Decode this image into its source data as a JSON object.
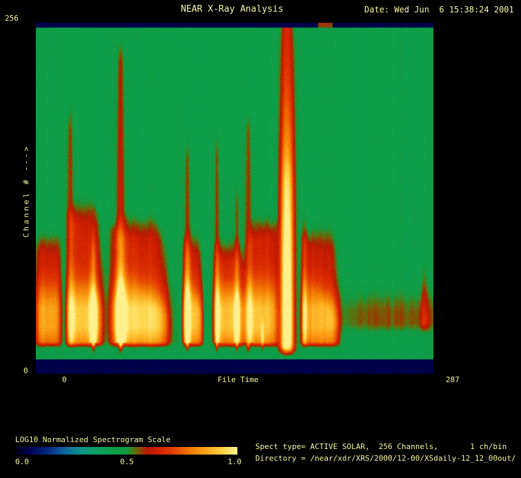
{
  "theme": {
    "background": "#000000",
    "text_color": "#f7f7a2"
  },
  "header": {
    "title": "NEAR X-Ray Analysis",
    "date": "Date: Wed Jun  6 15:38:24 2001"
  },
  "plot": {
    "y_axis": {
      "label": "Channel # --->",
      "max_label": "256",
      "min_label": "0"
    },
    "x_axis": {
      "title": "File Time",
      "min_label": "0",
      "max_label": "287"
    }
  },
  "colorbar": {
    "label": "LOG10 Normalized Spectrogram Scale",
    "ticks": [
      "0.0",
      "0.5",
      "1.0"
    ]
  },
  "info": {
    "line1": "Spect type= ACTIVE SOLAR,  256 Channels,       1 ch/bin",
    "line2": "Directory = /near/xdr/XRS/2000/12-00/XSdaily-12_12_00out/"
  },
  "chart_data": {
    "type": "heatmap",
    "title": "NEAR X-Ray Analysis spectrogram",
    "xlabel": "File Time",
    "ylabel": "Channel #",
    "x_range": [
      0,
      287
    ],
    "y_range": [
      0,
      256
    ],
    "scale_label": "LOG10 Normalized Spectrogram Scale",
    "scale_ticks": [
      0.0,
      0.5,
      1.0
    ],
    "background_level": 0.455,
    "strip_level": 0.046,
    "top_strip_mark": {
      "x0": 203.3,
      "x1": 214.2
    },
    "palette": [
      [
        0.0,
        "#000020"
      ],
      [
        0.05,
        "#00004e"
      ],
      [
        0.11,
        "#001c6e"
      ],
      [
        0.17,
        "#0a4292"
      ],
      [
        0.23,
        "#0c6f9e"
      ],
      [
        0.29,
        "#0d918b"
      ],
      [
        0.35,
        "#0e9f68"
      ],
      [
        0.42,
        "#0da151"
      ],
      [
        0.5,
        "#129a40"
      ],
      [
        0.53,
        "#4f7d14"
      ],
      [
        0.56,
        "#8a4a00"
      ],
      [
        0.59,
        "#b31a00"
      ],
      [
        0.64,
        "#d32000"
      ],
      [
        0.7,
        "#e23a00"
      ],
      [
        0.78,
        "#f17500"
      ],
      [
        0.86,
        "#fca71b"
      ],
      [
        0.93,
        "#ffd245"
      ],
      [
        1.0,
        "#fff08e"
      ]
    ],
    "events": [
      {
        "name": "flare-blob-1",
        "xc": 8.8,
        "bw": 9.2,
        "sw": 4.0,
        "st": 0.6,
        "tl": 0.66,
        "tr": 0.63,
        "amp": 0.4,
        "pe": 6
      },
      {
        "name": "flare-spike-2",
        "xc": 24.4,
        "bw": 3.0,
        "sw": 1.1,
        "st": 0.218,
        "tl": 0.62,
        "tr": 0.62,
        "amp": 0.33,
        "pe": 2
      },
      {
        "name": "flare-blob-2",
        "xc": 35.9,
        "bw": 12.4,
        "sw": 5.0,
        "st": 0.5,
        "tl": 0.561,
        "tr": 0.748,
        "amp": 0.46,
        "pe": 6
      },
      {
        "name": "flare-crest-2b",
        "xc": 41.3,
        "bw": 2.4,
        "sw": 1.0,
        "st": 0.59,
        "tl": 0.76,
        "tr": 0.76,
        "amp": 0.34,
        "pe": 2,
        "deep": true
      },
      {
        "name": "flare-spike-3",
        "xc": 61.0,
        "bw": 3.2,
        "sw": 1.4,
        "st": 0.017,
        "tl": 0.62,
        "tr": 0.62,
        "amp": 0.44,
        "pe": 2,
        "deep": true
      },
      {
        "name": "flare-blob-3",
        "xc": 74.7,
        "bw": 21.5,
        "sw": 8.0,
        "st": 0.55,
        "tl": 0.6,
        "tr": 0.8,
        "amp": 0.5,
        "pe": 6
      },
      {
        "name": "faint-line-a",
        "xc": 101.1,
        "bw": 1.6,
        "sw": 1.0,
        "st": 0.15,
        "tl": 0.93,
        "tr": 0.93,
        "amp": 0.07,
        "pe": 2
      },
      {
        "name": "flare-spike-4",
        "xc": 109.1,
        "bw": 2.2,
        "sw": 1.0,
        "st": 0.312,
        "tl": 0.64,
        "tr": 0.64,
        "amp": 0.36,
        "pe": 2,
        "deep": true
      },
      {
        "name": "flare-blob-4",
        "xc": 113.1,
        "bw": 7.2,
        "sw": 3.5,
        "st": 0.6,
        "tl": 0.635,
        "tr": 0.79,
        "amp": 0.44,
        "pe": 6
      },
      {
        "name": "flare-spike-5a",
        "xc": 130.5,
        "bw": 2.0,
        "sw": 1.0,
        "st": 0.3,
        "tl": 0.66,
        "tr": 0.66,
        "amp": 0.32,
        "pe": 2,
        "deep": true
      },
      {
        "name": "flare-blob-5",
        "xc": 139.4,
        "bw": 11.2,
        "sw": 5.0,
        "st": 0.62,
        "tl": 0.655,
        "tr": 0.74,
        "amp": 0.45,
        "pe": 6
      },
      {
        "name": "flare-spike-5b",
        "xc": 145.0,
        "bw": 1.8,
        "sw": 0.9,
        "st": 0.447,
        "tl": 0.74,
        "tr": 0.74,
        "amp": 0.31,
        "pe": 2,
        "deep": true
      },
      {
        "name": "flare-spike-6",
        "xc": 153.0,
        "bw": 3.0,
        "sw": 1.2,
        "st": 0.23,
        "tl": 0.68,
        "tr": 0.68,
        "amp": 0.34,
        "pe": 2,
        "deep": true
      },
      {
        "name": "flare-blob-6",
        "xc": 163.4,
        "bw": 11.0,
        "sw": 5.0,
        "st": 0.55,
        "tl": 0.675,
        "tr": 0.6,
        "amp": 0.45,
        "pe": 6
      },
      {
        "name": "tail-mark-6c",
        "xc": 163.4,
        "bw": 1.3,
        "sw": 0.9,
        "st": 0.86,
        "tl": 0.93,
        "tr": 0.93,
        "amp": 0.28,
        "pe": 2,
        "deep": true
      },
      {
        "name": "bright-column",
        "xc": 181.1,
        "bw": 5.3,
        "sw": 4.2,
        "st": 0.0,
        "tl": 0.1,
        "tr": 0.1,
        "amp": 0.56,
        "pe": 2.4,
        "kind": "column"
      },
      {
        "name": "column-glow",
        "xc": 181.1,
        "bw": 3.6,
        "sw": 3.0,
        "st": 0.36,
        "tl": 0.46,
        "tr": 0.46,
        "amp": 0.13,
        "pe": 2
      },
      {
        "name": "flare-spike-8",
        "xc": 193.5,
        "bw": 2.0,
        "sw": 1.0,
        "st": 0.54,
        "tl": 0.64,
        "tr": 0.64,
        "amp": 0.3,
        "pe": 2
      },
      {
        "name": "flare-blob-8",
        "xc": 205.5,
        "bw": 13.2,
        "sw": 6.0,
        "st": 0.58,
        "tl": 0.635,
        "tr": 0.81,
        "amp": 0.43,
        "pe": 6
      },
      {
        "name": "right-haze-band",
        "xc": 263.0,
        "bw": 46.0,
        "sw": 40.0,
        "st": 0.765,
        "tl": 0.8,
        "tr": 0.8,
        "amp": 0.12,
        "pe": 6,
        "hy": 0.835,
        "fs": 0.89,
        "fe": 0.94
      },
      {
        "name": "right-thin-line",
        "xc": 280.3,
        "bw": 2.6,
        "sw": 1.0,
        "st": 0.685,
        "tl": 0.9,
        "tr": 0.9,
        "amp": 0.26,
        "pe": 2,
        "fs": 0.88,
        "fe": 0.93
      }
    ]
  }
}
